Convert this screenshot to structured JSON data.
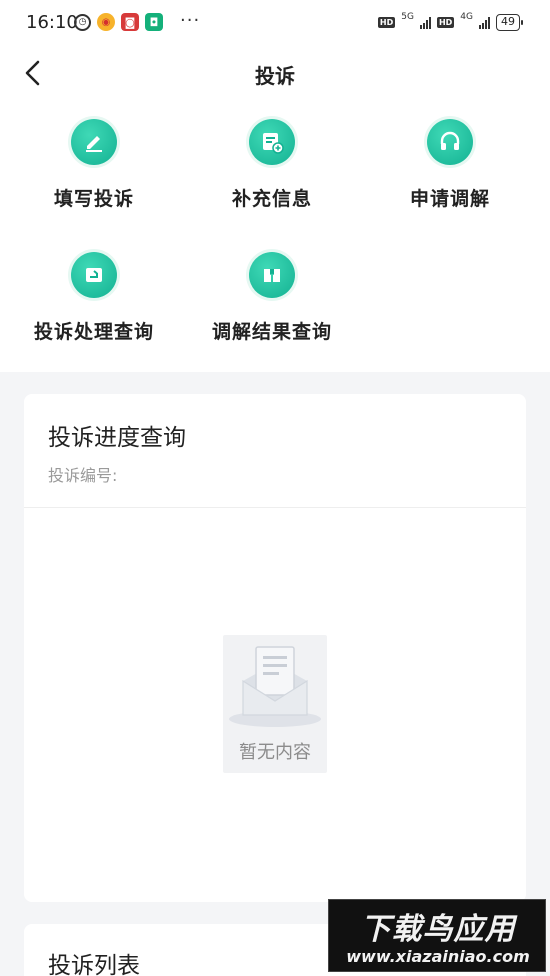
{
  "status_bar": {
    "time": "16:10",
    "more": "···",
    "hd1": "HD",
    "net1": "5G",
    "hd2": "HD",
    "net2": "4G",
    "battery": "49"
  },
  "header": {
    "title": "投诉"
  },
  "features": [
    {
      "label": "填写投诉",
      "icon": "pencil-icon"
    },
    {
      "label": "补充信息",
      "icon": "document-add-icon"
    },
    {
      "label": "申请调解",
      "icon": "headset-icon"
    },
    {
      "label": "投诉处理查询",
      "icon": "export-icon"
    },
    {
      "label": "调解结果查询",
      "icon": "book-icon"
    }
  ],
  "progress": {
    "title": "投诉进度查询",
    "number_label": "投诉编号:",
    "empty_text": "暂无内容"
  },
  "list": {
    "title": "投诉列表"
  },
  "watermark": {
    "big": "下载鸟应用",
    "small": "www.xiazainiao.com"
  },
  "colors": {
    "accent": "#13b192",
    "background": "#f4f5f7"
  }
}
